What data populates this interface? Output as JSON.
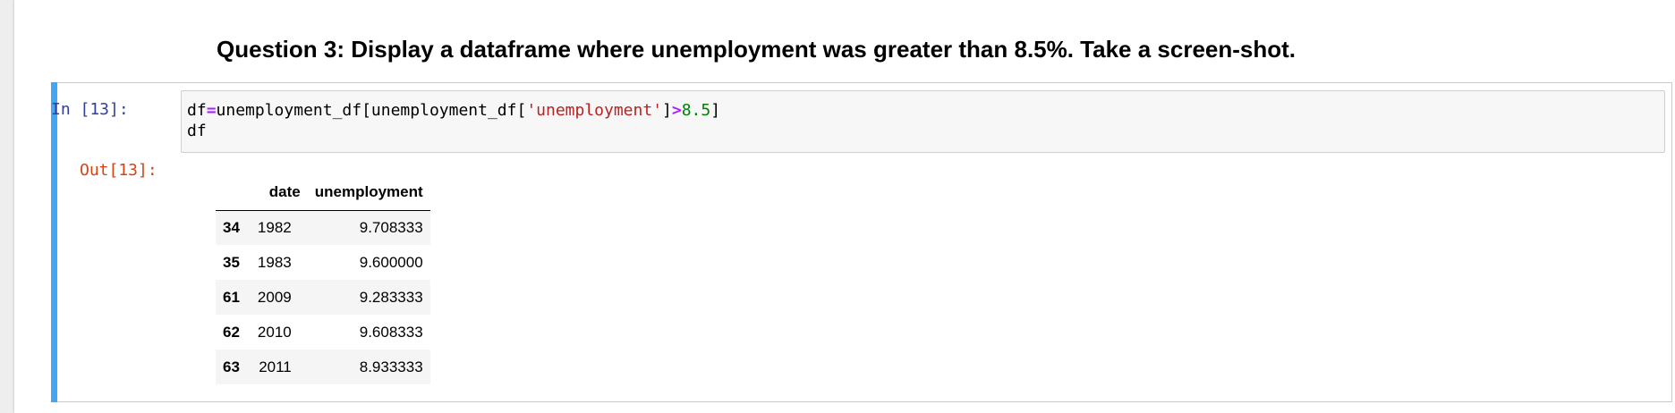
{
  "question": {
    "text": "Question 3: Display a dataframe where unemployment was greater than 8.5%. Take a screen-shot."
  },
  "cell": {
    "in_prompt": "In [13]:",
    "out_prompt": "Out[13]:",
    "code": {
      "line1": {
        "p1": "df",
        "op1": "=",
        "p2": "unemployment_df[unemployment_df[",
        "str": "'unemployment'",
        "p3": "]",
        "op2": ">",
        "num": "8.5",
        "p4": "]"
      },
      "line2": "df"
    },
    "accent_color": "#42a5f5"
  },
  "output_table": {
    "columns": [
      "",
      "date",
      "unemployment"
    ],
    "rows": [
      {
        "index": "34",
        "date": "1982",
        "unemployment": "9.708333"
      },
      {
        "index": "35",
        "date": "1983",
        "unemployment": "9.600000"
      },
      {
        "index": "61",
        "date": "2009",
        "unemployment": "9.283333"
      },
      {
        "index": "62",
        "date": "2010",
        "unemployment": "9.608333"
      },
      {
        "index": "63",
        "date": "2011",
        "unemployment": "8.933333"
      }
    ]
  }
}
